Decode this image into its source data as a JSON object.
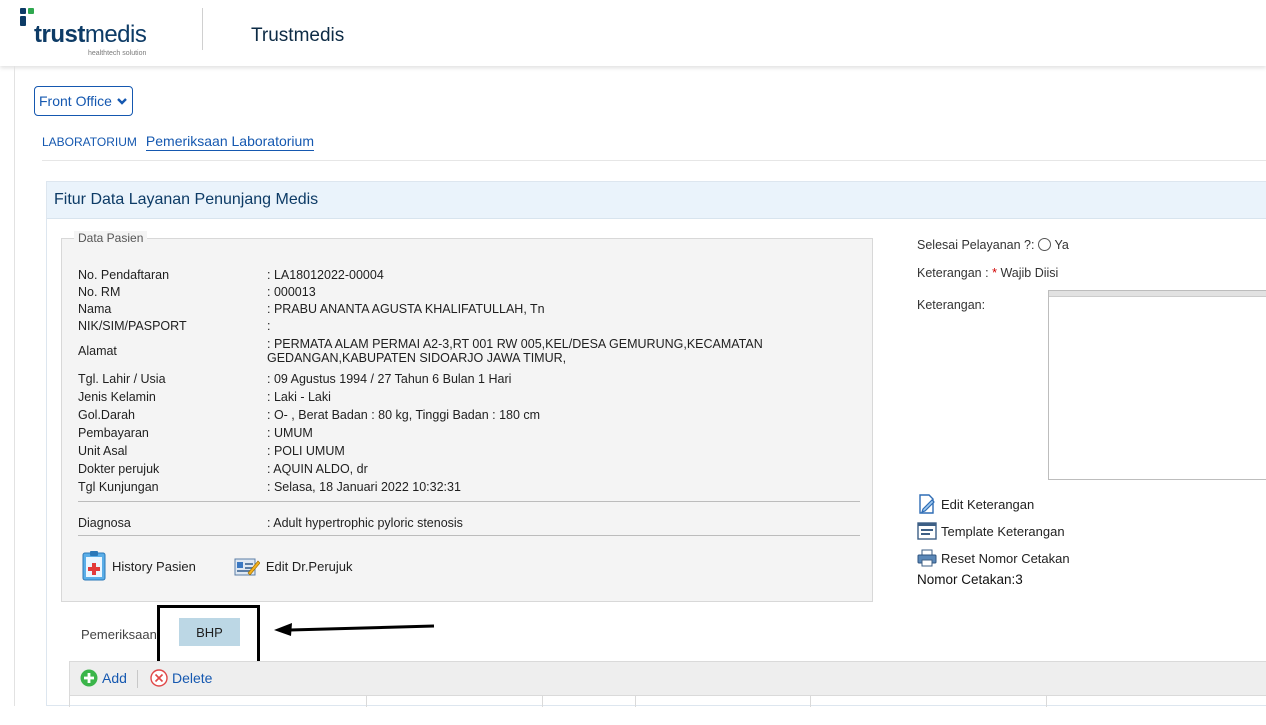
{
  "header": {
    "logo_bold": "trust",
    "logo_normal": "medis",
    "logo_tagline": "healthtech solution",
    "app_title": "Trustmedis"
  },
  "nav": {
    "module_select": "Front Office"
  },
  "breadcrumb": {
    "section": "LABORATORIUM",
    "current": "Pemeriksaan Laboratorium"
  },
  "panel": {
    "title": "Fitur Data Layanan Penunjang Medis"
  },
  "patient": {
    "legend": "Data Pasien",
    "rows": [
      {
        "label": "No. Pendaftaran",
        "value": ": LA18012022-00004"
      },
      {
        "label": "No. RM",
        "value": ": 000013"
      },
      {
        "label": "Nama",
        "value": ": PRABU ANANTA AGUSTA KHALIFATULLAH, Tn"
      },
      {
        "label": "NIK/SIM/PASPORT",
        "value": ":"
      },
      {
        "label": "Alamat",
        "value": ": PERMATA ALAM PERMAI A2-3,RT 001 RW 005,KEL/DESA GEMURUNG,KECAMATAN GEDANGAN,KABUPATEN SIDOARJO JAWA TIMUR,"
      },
      {
        "label": "Tgl. Lahir / Usia",
        "value": ": 09 Agustus 1994 / 27 Tahun 6 Bulan 1 Hari"
      },
      {
        "label": "Jenis Kelamin",
        "value": ": Laki - Laki"
      },
      {
        "label": "Gol.Darah",
        "value": ": O- , Berat Badan : 80 kg, Tinggi Badan : 180 cm"
      },
      {
        "label": "Pembayaran",
        "value": ": UMUM"
      },
      {
        "label": "Unit Asal",
        "value": ": POLI UMUM"
      },
      {
        "label": "Dokter perujuk",
        "value": ": AQUIN ALDO, dr"
      },
      {
        "label": "Tgl Kunjungan",
        "value": ": Selasa, 18 Januari 2022 10:32:31"
      }
    ],
    "diagnosa_label": "Diagnosa",
    "diagnosa_value": ": Adult hypertrophic pyloric stenosis",
    "history_button": "History Pasien",
    "edit_perujuk_button": "Edit Dr.Perujuk"
  },
  "right": {
    "selesai_label": "Selesai Pelayanan ?:",
    "selesai_option": "Ya",
    "keterangan_req_label": "Keterangan :",
    "keterangan_req_star": "*",
    "keterangan_req_text": "Wajib Diisi",
    "keterangan_label": "Keterangan:",
    "edit_keterangan": "Edit Keterangan",
    "template_keterangan": "Template Keterangan",
    "reset_nomor": "Reset Nomor Cetakan",
    "nomor_cetakan": "Nomor Cetakan:3"
  },
  "tabs": {
    "pemeriksaan": "Pemeriksaan",
    "bhp": "BHP"
  },
  "toolbar": {
    "add": "Add",
    "delete": "Delete"
  },
  "colors": {
    "accent": "#1558b0",
    "panel_header": "#eaf3fb",
    "active_tab": "#bcd7e5"
  }
}
